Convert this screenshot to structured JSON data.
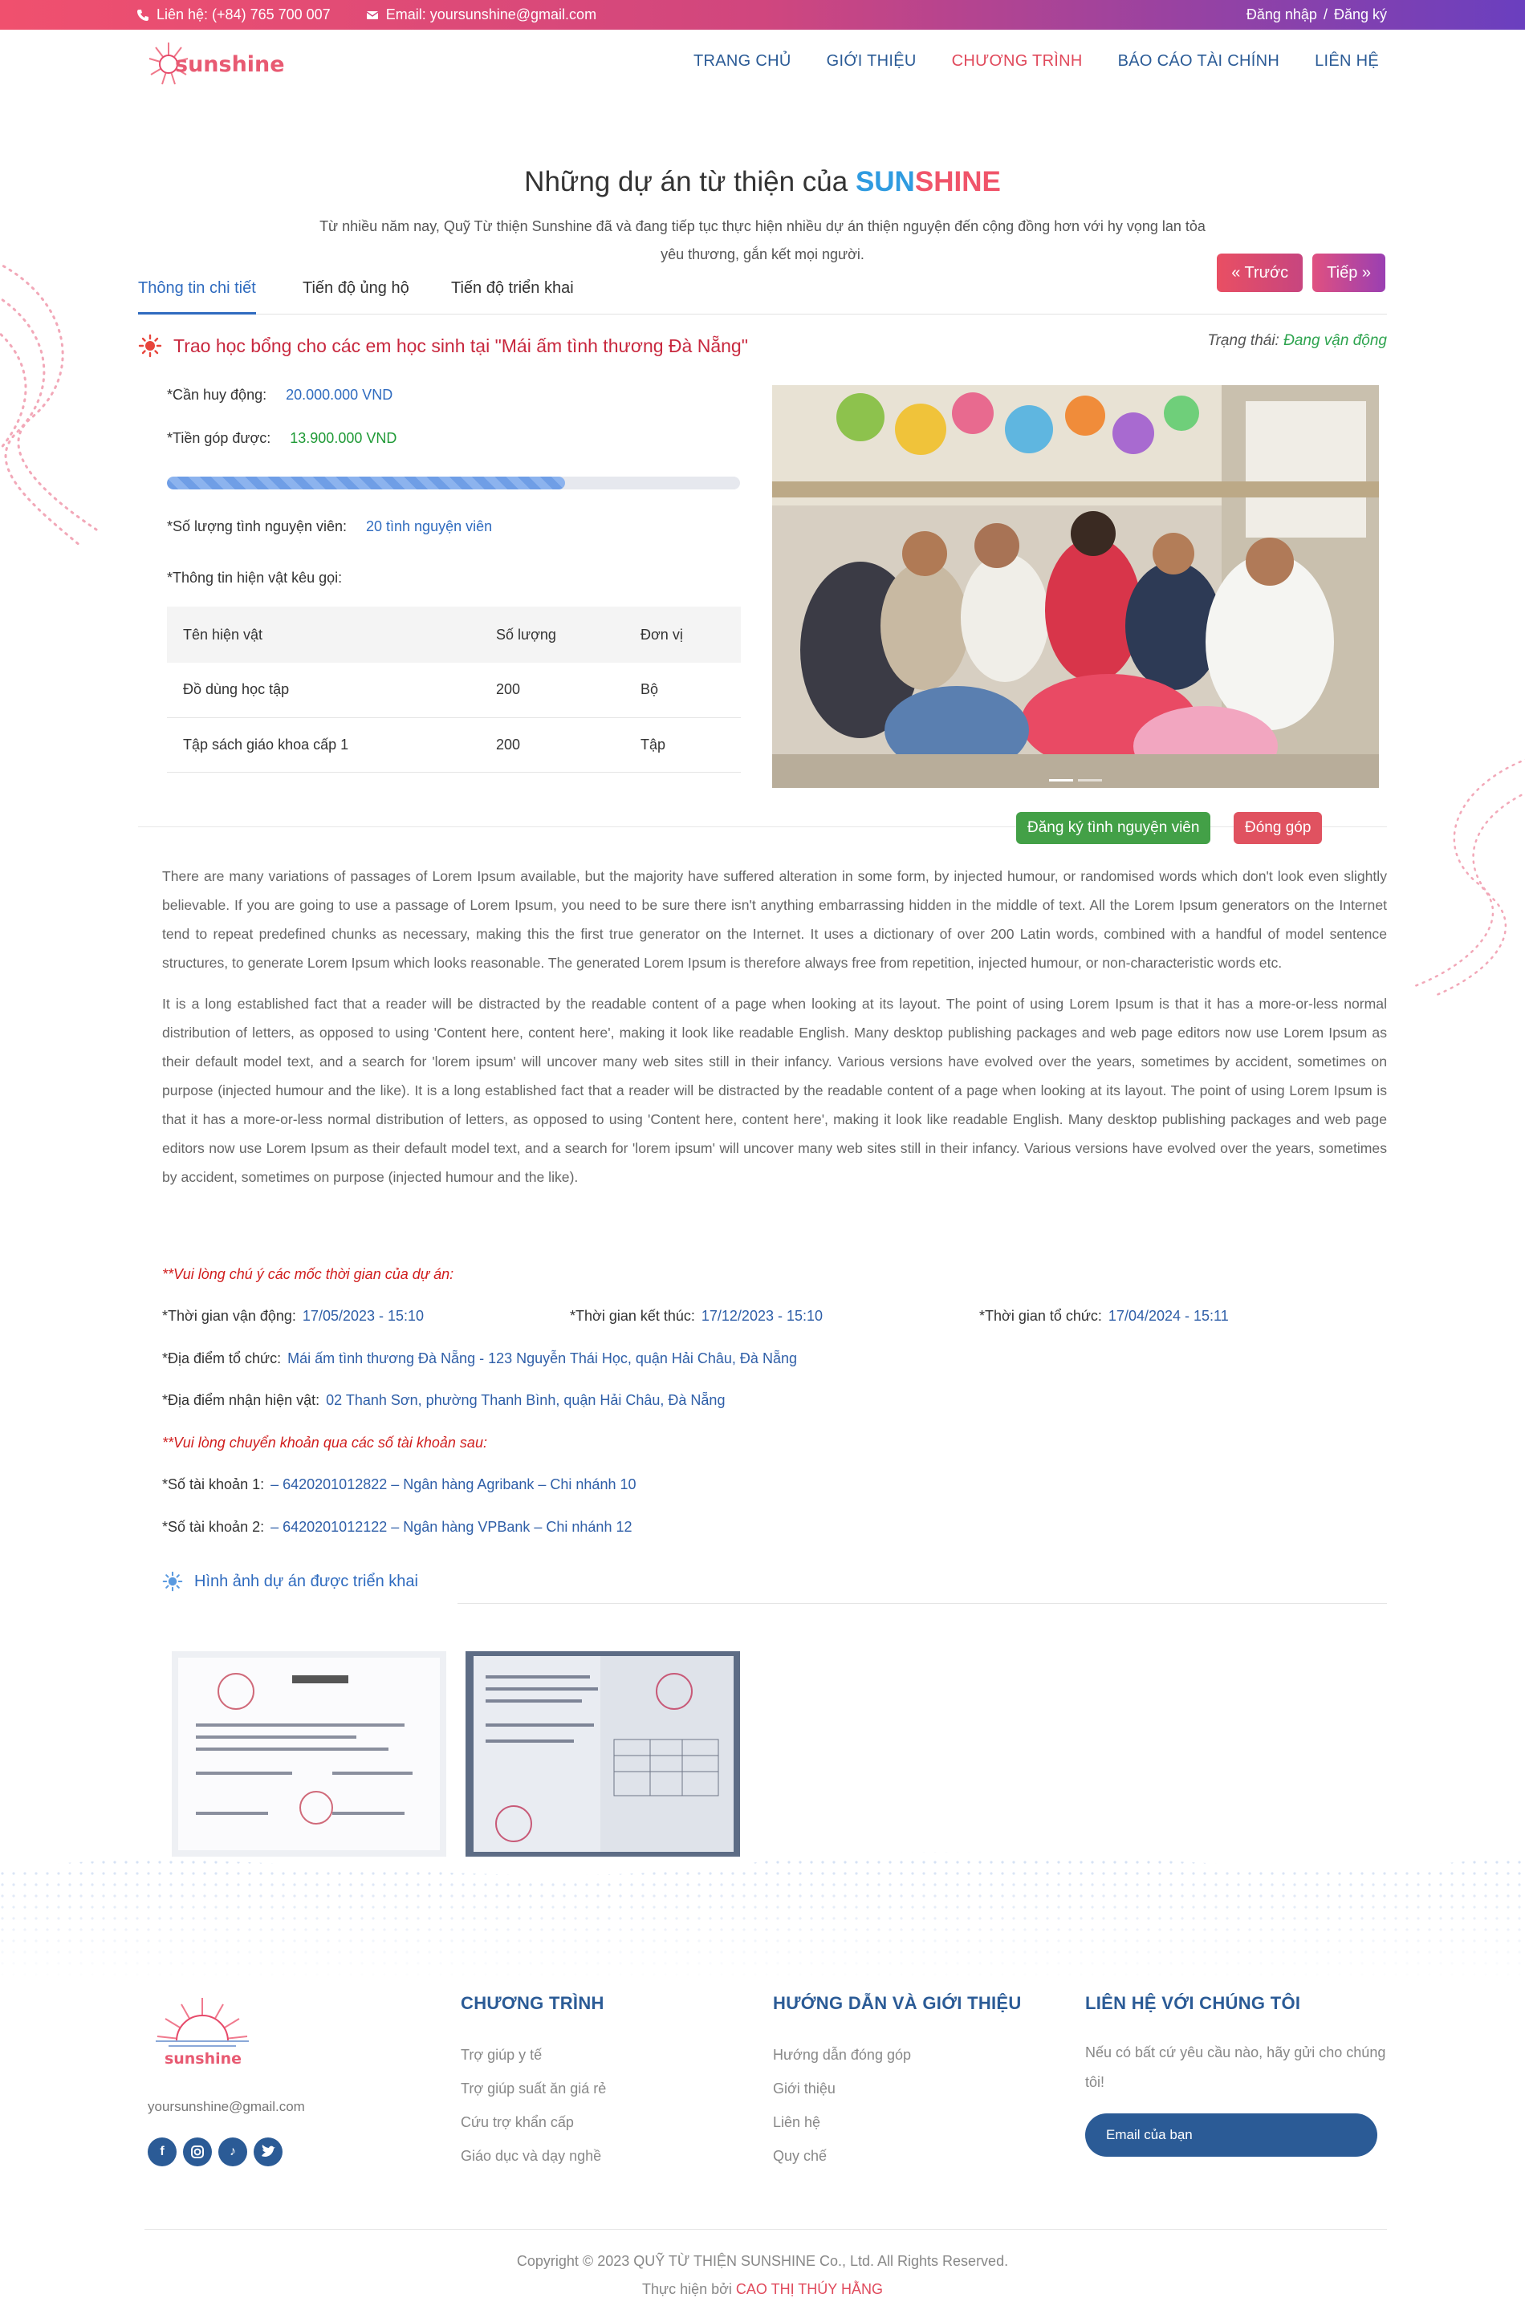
{
  "topbar": {
    "phone": "Liên hệ: (+84) 765 700 007",
    "email": "Email: yoursunshine@gmail.com",
    "login": "Đăng nhập",
    "sep": "/",
    "register": "Đăng ký"
  },
  "brand": {
    "name": "sunshine"
  },
  "nav": [
    "TRANG CHỦ",
    "GIỚI THIỆU",
    "CHƯƠNG TRÌNH",
    "BÁO CÁO TÀI CHÍNH",
    "LIÊN HỆ"
  ],
  "hero": {
    "title_prefix": "Những dự án từ thiện của ",
    "title_sun": "SUN",
    "title_shine": "SHINE",
    "desc": "Từ nhiều năm nay, Quỹ Từ thiện Sunshine đã và đang tiếp tục thực hiện nhiều dự án thiện nguyện đến cộng đồng hơn với hy vọng lan tỏa yêu thương, gắn kết mọi người."
  },
  "tabs": [
    "Thông tin chi tiết",
    "Tiến độ ủng hộ",
    "Tiến độ triển khai"
  ],
  "pager": {
    "prev": "« Trước",
    "next": "Tiếp »"
  },
  "project": {
    "title": "Trao học bổng cho các em học sinh tại \"Mái ấm tình thương Đà Nẵng\"",
    "status_label": "Trạng thái:",
    "status_value": "Đang vận động",
    "goal_label": "*Cần huy động:",
    "goal_value": "20.000.000 VND",
    "raised_label": "*Tiền góp được:",
    "raised_value": "13.900.000 VND",
    "progress": 0.695,
    "volunteers_label": "*Số lượng tình nguyện viên:",
    "volunteers_value": "20 tình nguyện viên",
    "goods_label": "*Thông tin hiện vật kêu gọi:",
    "goods_headers": [
      "Tên hiện vật",
      "Số lượng",
      "Đơn vị"
    ],
    "goods_rows": [
      [
        "Đồ dùng học tập",
        "200",
        "Bộ"
      ],
      [
        "Tập sách giáo khoa cấp 1",
        "200",
        "Tập"
      ]
    ],
    "btn_volunteer": "Đăng ký tình nguyện viên",
    "btn_donate": "Đóng góp"
  },
  "description": [
    "There are many variations of passages of Lorem Ipsum available, but the majority have suffered alteration in some form, by injected humour, or randomised words which don't look even slightly believable. If you are going to use a passage of Lorem Ipsum, you need to be sure there isn't anything embarrassing hidden in the middle of text. All the Lorem Ipsum generators on the Internet tend to repeat predefined chunks as necessary, making this the first true generator on the Internet. It uses a dictionary of over 200 Latin words, combined with a handful of model sentence structures, to generate Lorem Ipsum which looks reasonable. The generated Lorem Ipsum is therefore always free from repetition, injected humour, or non-characteristic words etc.",
    "It is a long established fact that a reader will be distracted by the readable content of a page when looking at its layout. The point of using Lorem Ipsum is that it has a more-or-less normal distribution of letters, as opposed to using 'Content here, content here', making it look like readable English. Many desktop publishing packages and web page editors now use Lorem Ipsum as their default model text, and a search for 'lorem ipsum' will uncover many web sites still in their infancy. Various versions have evolved over the years, sometimes by accident, sometimes on purpose (injected humour and the like). It is a long established fact that a reader will be distracted by the readable content of a page when looking at its layout. The point of using Lorem Ipsum is that it has a more-or-less normal distribution of letters, as opposed to using 'Content here, content here', making it look like readable English. Many desktop publishing packages and web page editors now use Lorem Ipsum as their default model text, and a search for 'lorem ipsum' will uncover many web sites still in their infancy. Various versions have evolved over the years, sometimes by accident, sometimes on purpose (injected humour and the like)."
  ],
  "schedule": {
    "note": "**Vui lòng chú ý các mốc thời gian của dự án:",
    "campaign_label": "*Thời gian vận động:",
    "campaign_value": "17/05/2023 - 15:10",
    "end_label": "*Thời gian kết thúc:",
    "end_value": "17/12/2023 - 15:10",
    "event_label": "*Thời gian tổ chức:",
    "event_value": "17/04/2024 - 15:11",
    "venue_label": "*Địa điểm tổ chức:",
    "venue_value": "Mái ấm tình thương Đà Nẵng - 123 Nguyễn Thái Học, quận Hải Châu, Đà Nẵng",
    "dropoff_label": "*Địa điểm nhận hiện vật:",
    "dropoff_value": "02 Thanh Sơn, phường Thanh Bình, quận Hải Châu, Đà Nẵng"
  },
  "bank": {
    "note": "**Vui lòng chuyển khoản qua các số tài khoản sau:",
    "acc1_label": "*Số tài khoản 1:",
    "acc1_value": "– 6420201012822 – Ngân hàng Agribank – Chi nhánh 10",
    "acc2_label": "*Số tài khoản 2:",
    "acc2_value": "– 6420201012122 – Ngân hàng VPBank – Chi nhánh 12"
  },
  "gallery": {
    "title": "Hình ảnh dự án được triển khai"
  },
  "footer": {
    "email": "yoursunshine@gmail.com",
    "col1_title": "CHƯƠNG TRÌNH",
    "col1_links": [
      "Trợ giúp y tế",
      "Trợ giúp suất ăn giá rẻ",
      "Cứu trợ khẩn cấp",
      "Giáo dục và dạy nghề"
    ],
    "col2_title": "HƯỚNG DẪN VÀ GIỚI THIỆU",
    "col2_links": [
      "Hướng dẫn đóng góp",
      "Giới thiệu",
      "Liên hệ",
      "Quy chế"
    ],
    "col3_title": "LIÊN HỆ VỚI CHÚNG TÔI",
    "col3_text": "Nếu có bất cứ yêu cầu nào, hãy gửi cho chúng tôi!",
    "email_placeholder": "Email của bạn",
    "copyright": "Copyright © 2023 QUỸ TỪ THIỆN SUNSHINE Co., Ltd. All Rights Reserved.",
    "credit_prefix": "Thực hiện bởi ",
    "credit_name": "CAO THỊ THÚY HẰNG"
  },
  "colors": {
    "brand_blue": "#2b5b96",
    "accent_red": "#e04a5c",
    "sun_blue": "#2f9be0",
    "green": "#43a047"
  }
}
